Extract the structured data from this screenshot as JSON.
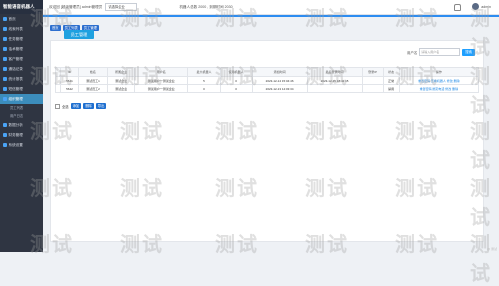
{
  "app": {
    "brand": "智能语音机器人"
  },
  "sidebar": {
    "items": [
      {
        "label": "首页"
      },
      {
        "label": "线索列表"
      },
      {
        "label": "任务管理"
      },
      {
        "label": "话术管理"
      },
      {
        "label": "客户管理"
      },
      {
        "label": "通话记录"
      },
      {
        "label": "统计报表"
      },
      {
        "label": "短信管理"
      },
      {
        "label": "组织管理"
      },
      {
        "label": "员工列表"
      },
      {
        "label": "用户日志"
      },
      {
        "label": "数据分析"
      },
      {
        "label": "财务管理"
      },
      {
        "label": "系统设置"
      }
    ]
  },
  "topbar": {
    "welcome": "欢迎回 [超级管理员] admin管理员",
    "select_value": "请选择企业",
    "robots": "机器人总数 2000 , 到期时间 2030",
    "username": "admin"
  },
  "crumbs": [
    "首页",
    "员工列表",
    "员工管理"
  ],
  "page": {
    "title": "员工管理",
    "search_label": "用户名",
    "search_placeholder": "请输入用户名",
    "search_button": "搜索"
  },
  "table": {
    "headers": [
      "",
      "ID",
      "姓名",
      "所属企业",
      "用户名",
      "最大机器人",
      "使用机器人",
      "添加时间",
      "最后登录时间",
      "登录IP",
      "状态",
      "操作"
    ],
    "rows": [
      [
        "",
        "5641",
        "测试员工1",
        "测试企业",
        "测试用户一测试企业",
        "5",
        "0",
        "2023-12-14 15:04:46",
        "2023-12-15 18:42:15",
        "",
        "正常",
        "重置密码 查看机器人 修改 删除"
      ],
      [
        "",
        "5642",
        "测试员工2",
        "测试企业",
        "测试用户一测试企业",
        "0",
        "0",
        "2023-12-13 14:03:34",
        "",
        "",
        "禁用",
        "重置密码 绑定电话 修改 删除"
      ]
    ]
  },
  "actions": {
    "select_all": "全选",
    "buttons": [
      "添加",
      "删除",
      "导出"
    ]
  },
  "watermark": "测试",
  "corner": "@ 测试"
}
